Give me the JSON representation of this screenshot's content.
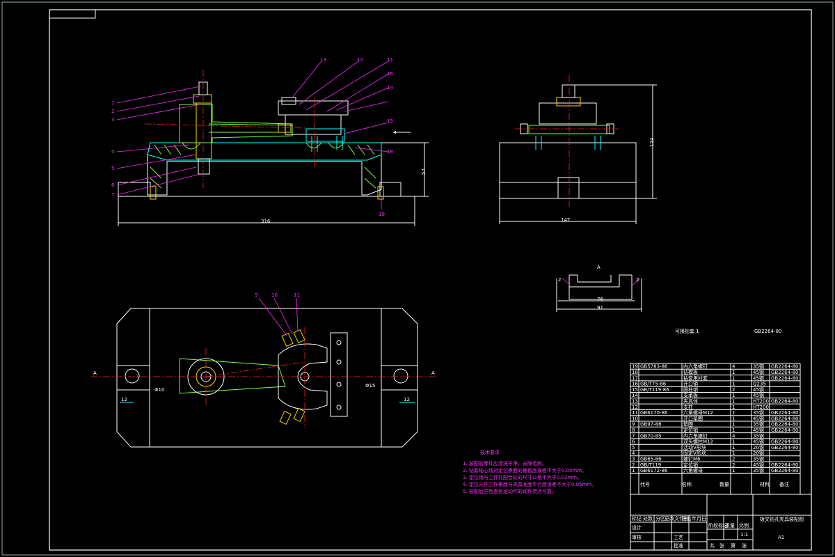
{
  "drawing": {
    "dimensions": {
      "front_width": "316",
      "front_height": "57",
      "side_width": "147",
      "side_height": "124",
      "detail_inner": "76",
      "detail_outer": "91",
      "detail_left": "2",
      "detail_right": "2",
      "plan_left": "12",
      "plan_right": "12"
    },
    "section_marks": {
      "a_left": "A",
      "a_right": "A",
      "detail_label": "A"
    },
    "balloons_front_left": [
      "1",
      "2",
      "3",
      "4",
      "5",
      "6",
      "7"
    ],
    "balloons_front_top": [
      "13",
      "12",
      "11",
      "16",
      "14",
      "15",
      "18",
      "19"
    ],
    "balloons_plan": [
      "9",
      "10",
      "11"
    ],
    "plan_small_labels": [
      "Φ10",
      "Φ15"
    ],
    "notes_title": "技术要求",
    "notes": [
      "1. 装配前零件应清洗干净，去除毛刺。",
      "2. 钻套轴心线对定位表面的垂直度误差不大于0.05mm。",
      "3. 定位销与工件孔配合处的尺寸公差不大于0.02mm。",
      "4. 定位元件工作表面与夹具底面平行度误差不大于0.05mm。",
      "5. 装配后应检查各运动件的动作灵活可靠。"
    ],
    "list_caption": "可换钻套 1",
    "list_caption_code": "GB2264-80"
  },
  "title_block": {
    "header_cells": [
      "序号",
      "代号",
      "名称",
      "数量",
      "材料",
      "备注"
    ],
    "rows": [
      [
        "19",
        "GB5783-86",
        "内六角螺钉",
        "4",
        "35钢",
        "GB2264-80"
      ],
      [
        "18",
        "",
        "钻模板",
        "1",
        "45钢",
        "GB2264-80"
      ],
      [
        "17",
        "",
        "钻套用衬套",
        "1",
        "45钢",
        "GB2264-80"
      ],
      [
        "16",
        "GB/T75-86",
        "开口销",
        "1",
        "Q235",
        ""
      ],
      [
        "15",
        "GB/T119-86",
        "圆柱销",
        "2",
        "45钢",
        ""
      ],
      [
        "14",
        "",
        "支承板",
        "1",
        "45钢",
        ""
      ],
      [
        "13",
        "",
        "夹具体",
        "1",
        "HT200",
        "GB2264-80"
      ],
      [
        "12",
        "",
        "支柱",
        "1",
        "HT200",
        ""
      ],
      [
        "11",
        "GB6170-86",
        "六角螺母M12",
        "1",
        "35钢",
        "GB2264-80"
      ],
      [
        "10",
        "",
        "开口垫圈",
        "1",
        "45钢",
        "GB2264-80"
      ],
      [
        "9",
        "GB97-86",
        "垫圈",
        "1",
        "35钢",
        "GB2264-80"
      ],
      [
        "8",
        "",
        "定位销",
        "1",
        "45钢",
        "GB2264-80"
      ],
      [
        "7",
        "GB70-85",
        "内六角螺钉",
        "4",
        "35钢",
        ""
      ],
      [
        "6",
        "",
        "双头螺柱M12",
        "1",
        "45钢",
        "GB2264-80"
      ],
      [
        "5",
        "",
        "活动V形块",
        "1",
        "20钢",
        "GB2264-80"
      ],
      [
        "4",
        "",
        "固定V形块",
        "1",
        "20钢",
        ""
      ],
      [
        "3",
        "GB65-86",
        "螺钉M6",
        "2",
        "35钢",
        ""
      ],
      [
        "2",
        "GB/T119",
        "定位销",
        "2",
        "45钢",
        "GB2264-80"
      ],
      [
        "1",
        "GB6172-86",
        "六角螺母",
        "1",
        "35钢",
        "GB2264-80"
      ]
    ],
    "footer": [
      "代号",
      "名称",
      "数量",
      "材料",
      "备注"
    ],
    "drawing_title": "拨叉钻孔夹具装配图",
    "scale": "1:1",
    "sheet": "A1",
    "stage_labels": [
      "阶段标记",
      "重量",
      "比例"
    ],
    "sign_labels": [
      "标记",
      "处数",
      "分区",
      "更改文件号",
      "签名",
      "年月日"
    ],
    "role_labels": [
      "设计",
      "审核",
      "工艺",
      "批准"
    ],
    "sheet_labels": [
      "共",
      "张",
      "第",
      "张"
    ]
  }
}
